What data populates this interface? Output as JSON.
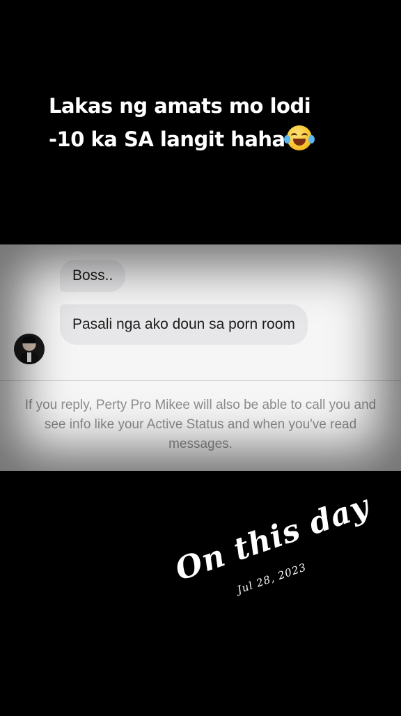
{
  "caption": {
    "line1": "Lakas ng amats mo lodi",
    "line2": "-10 ka SA langit haha",
    "emoji": "face-with-tears-of-joy"
  },
  "chat": {
    "messages": [
      "Boss..",
      "Pasali nga ako doun sa porn room"
    ],
    "notice": "If you reply, Perty Pro Mikee will also be able to call you and see info like your Active Status and when you've read messages."
  },
  "memory": {
    "title": "On this day",
    "date": "Jul 28, 2023"
  }
}
